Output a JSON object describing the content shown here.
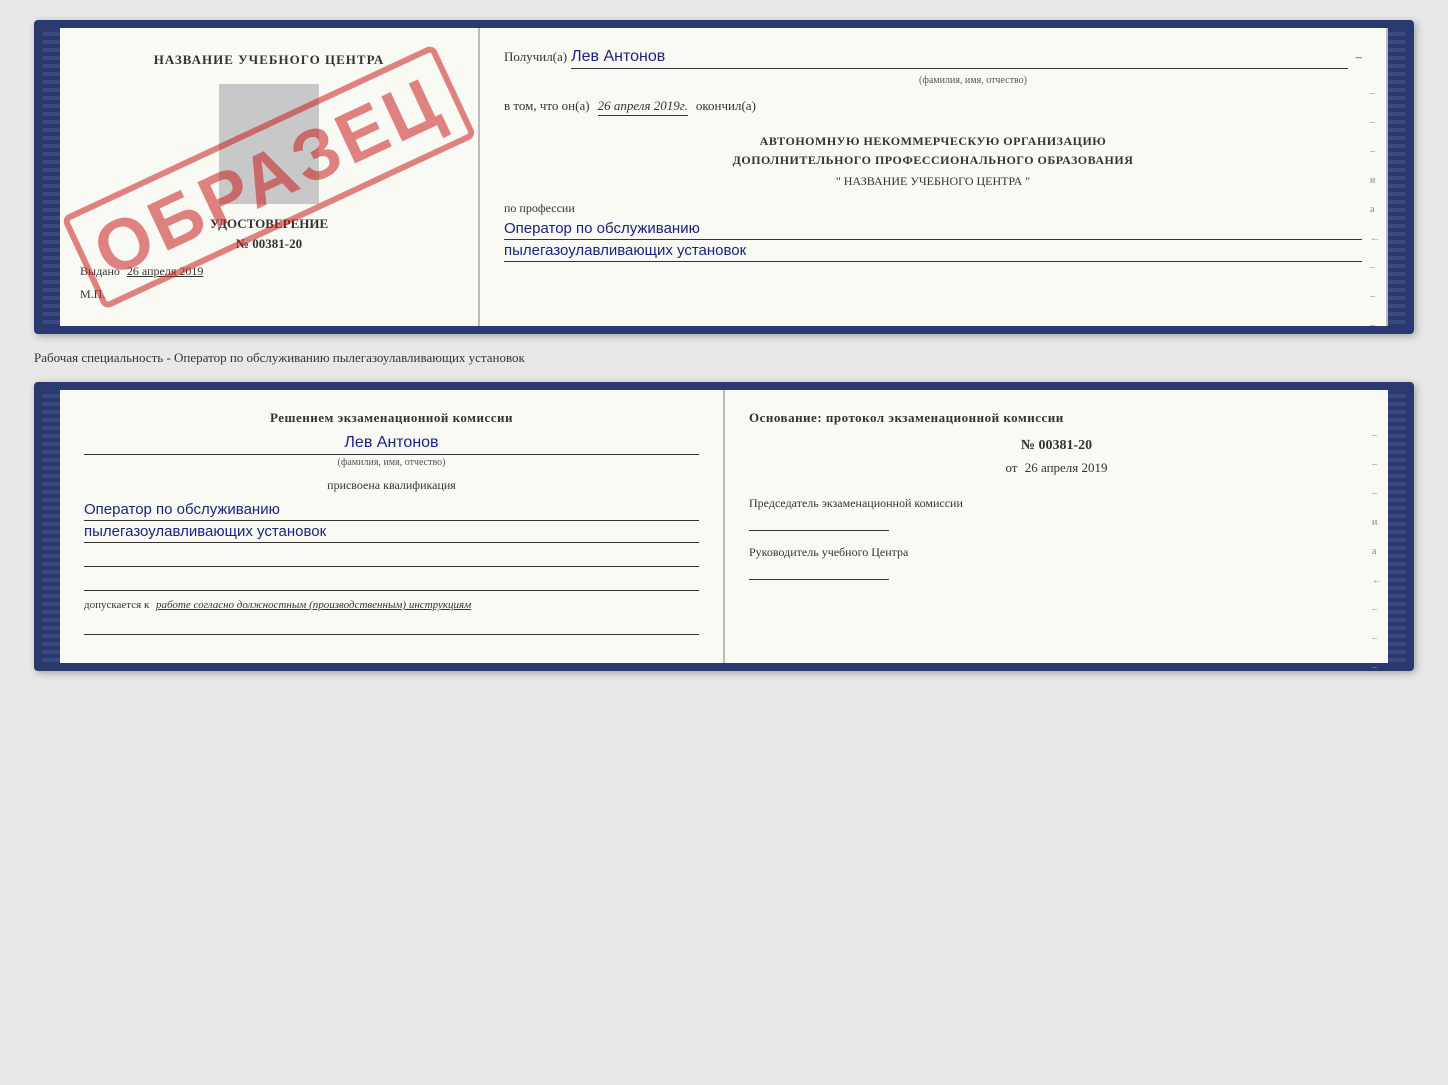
{
  "top_certificate": {
    "left_page": {
      "title": "НАЗВАНИЕ УЧЕБНОГО ЦЕНТРА",
      "subtitle": "УДОСТОВЕРЕНИЕ",
      "number": "№ 00381-20",
      "issued_label": "Выдано",
      "issued_date": "26 апреля 2019",
      "mp_label": "М.П.",
      "obrazec": "ОБРАЗЕЦ"
    },
    "right_page": {
      "received_label": "Получил(а)",
      "received_name": "Лев Антонов",
      "fio_hint": "(фамилия, имя, отчество)",
      "completed_prefix": "в том, что он(а)",
      "completed_date": "26 апреля 2019г.",
      "completed_suffix": "окончил(а)",
      "org_line1": "АВТОНОМНУЮ НЕКОММЕРЧЕСКУЮ ОРГАНИЗАЦИЮ",
      "org_line2": "ДОПОЛНИТЕЛЬНОГО ПРОФЕССИОНАЛЬНОГО ОБРАЗОВАНИЯ",
      "org_name": "\"   НАЗВАНИЕ УЧЕБНОГО ЦЕНТРА   \"",
      "profession_label": "по профессии",
      "profession_line1": "Оператор по обслуживанию",
      "profession_line2": "пылегазоулавливающих установок",
      "side_marks": [
        "-",
        "-",
        "-",
        "и",
        "а",
        "←",
        "-",
        "-",
        "-"
      ]
    }
  },
  "separator": {
    "text": "Рабочая специальность - Оператор по обслуживанию пылегазоулавливающих установок"
  },
  "bottom_certificate": {
    "left_page": {
      "decision_title": "Решением экзаменационной комиссии",
      "person_name": "Лев Антонов",
      "fio_hint": "(фамилия, имя, отчество)",
      "assigned_label": "присвоена квалификация",
      "qualification_line1": "Оператор по обслуживанию",
      "qualification_line2": "пылегазоулавливающих установок",
      "admitted_prefix": "допускается к",
      "admitted_text": "работе согласно должностным (производственным) инструкциям"
    },
    "right_page": {
      "basis_title": "Основание: протокол экзаменационной комиссии",
      "basis_number": "№ 00381-20",
      "basis_date_prefix": "от",
      "basis_date": "26 апреля 2019",
      "chairman_label": "Председатель экзаменационной комиссии",
      "director_label": "Руководитель учебного Центра",
      "side_marks": [
        "-",
        "-",
        "-",
        "и",
        "а",
        "←",
        "-",
        "-",
        "-"
      ]
    }
  }
}
